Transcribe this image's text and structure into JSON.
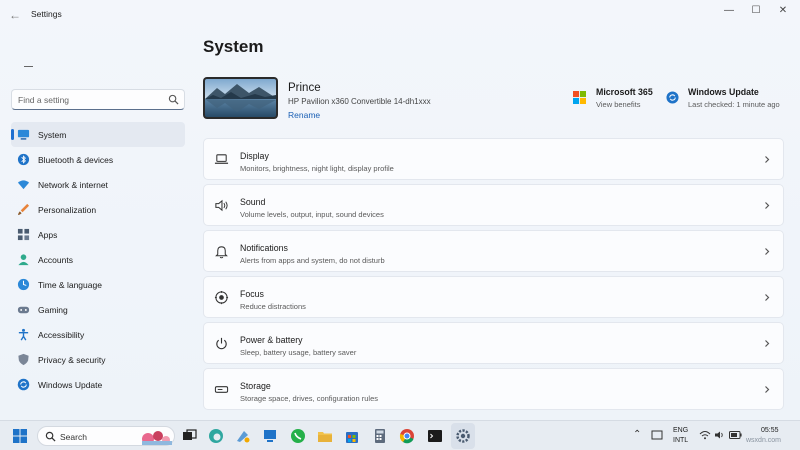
{
  "window": {
    "title": "Settings",
    "back": "←",
    "controls": {
      "minimize": "—",
      "maximize": "☐",
      "close": "✕"
    }
  },
  "sidebar": {
    "search_placeholder": "Find a setting",
    "items": [
      {
        "label": "System",
        "icon": "monitor-icon",
        "active": true
      },
      {
        "label": "Bluetooth & devices",
        "icon": "bluetooth-icon"
      },
      {
        "label": "Network & internet",
        "icon": "wifi-icon"
      },
      {
        "label": "Personalization",
        "icon": "paintbrush-icon"
      },
      {
        "label": "Apps",
        "icon": "apps-icon"
      },
      {
        "label": "Accounts",
        "icon": "person-icon"
      },
      {
        "label": "Time & language",
        "icon": "globe-clock-icon"
      },
      {
        "label": "Gaming",
        "icon": "gamepad-icon"
      },
      {
        "label": "Accessibility",
        "icon": "accessibility-icon"
      },
      {
        "label": "Privacy & security",
        "icon": "shield-icon"
      },
      {
        "label": "Windows Update",
        "icon": "update-icon"
      }
    ]
  },
  "main": {
    "title": "System",
    "device": {
      "name": "Prince",
      "model": "HP Pavilion x360 Convertible 14-dh1xxx",
      "rename": "Rename"
    },
    "promos": [
      {
        "title": "Microsoft 365",
        "subtitle": "View benefits",
        "icon": "microsoft-logo-icon"
      },
      {
        "title": "Windows Update",
        "subtitle": "Last checked: 1 minute ago",
        "icon": "update-icon"
      }
    ],
    "cards": [
      {
        "title": "Display",
        "subtitle": "Monitors, brightness, night light, display profile",
        "icon": "laptop-icon"
      },
      {
        "title": "Sound",
        "subtitle": "Volume levels, output, input, sound devices",
        "icon": "speaker-icon"
      },
      {
        "title": "Notifications",
        "subtitle": "Alerts from apps and system, do not disturb",
        "icon": "bell-icon"
      },
      {
        "title": "Focus",
        "subtitle": "Reduce distractions",
        "icon": "focus-icon"
      },
      {
        "title": "Power & battery",
        "subtitle": "Sleep, battery usage, battery saver",
        "icon": "power-icon"
      },
      {
        "title": "Storage",
        "subtitle": "Storage space, drives, configuration rules",
        "icon": "storage-icon"
      }
    ]
  },
  "taskbar": {
    "search_label": "Search",
    "language_top": "ENG",
    "language_bottom": "INTL",
    "time": "05:55",
    "date": "",
    "watermark": "wsxdn.com"
  },
  "colors": {
    "accent": "#1e6fd0",
    "window_bg": "#f0f4f9",
    "card_bg": "#fbfcfe"
  }
}
